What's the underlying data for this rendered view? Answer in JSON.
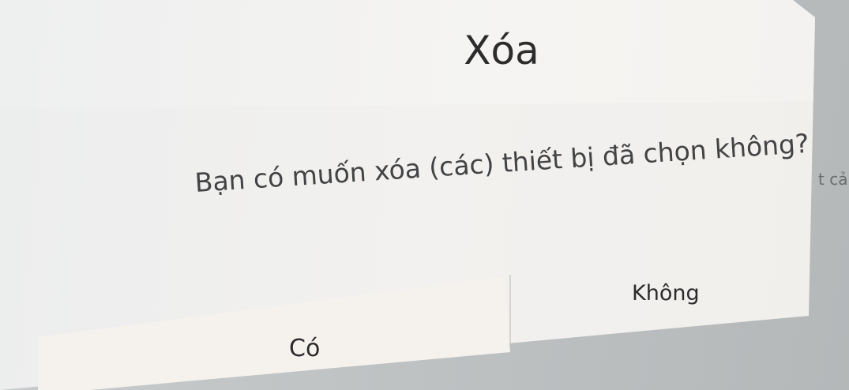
{
  "dialog": {
    "title": "Xóa",
    "message": "Bạn có muốn xóa (các) thiết bị đã chọn không?",
    "yes_label": "Có",
    "no_label": "Không"
  },
  "background": {
    "partial_text": "t cả"
  }
}
